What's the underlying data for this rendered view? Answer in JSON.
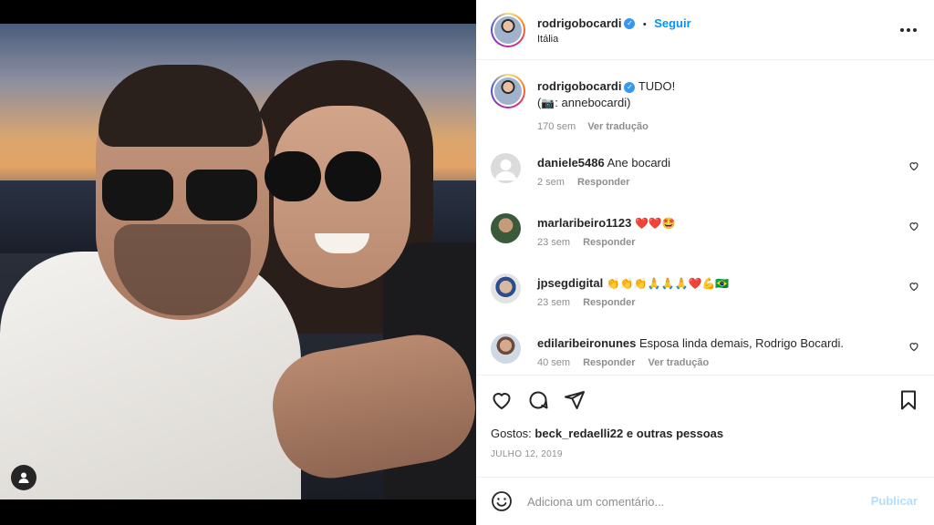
{
  "post": {
    "tag_icon": "user-tag-icon"
  },
  "header": {
    "username": "rodrigobocardi",
    "separator": "•",
    "follow_label": "Seguir",
    "location": "Itália",
    "more_icon": "more-options-icon"
  },
  "caption": {
    "username": "rodrigobocardi",
    "text": "TUDO!",
    "line2_prefix": "(",
    "camera_emoji": "📷",
    "line2_suffix": ": annebocardi)",
    "time": "170 sem",
    "translate": "Ver tradução"
  },
  "comments": [
    {
      "username": "daniele5486",
      "text": "Ane bocardi",
      "time": "2 sem",
      "reply": "Responder",
      "translate": ""
    },
    {
      "username": "marlaribeiro1123",
      "text": "❤️❤️🤩",
      "time": "23 sem",
      "reply": "Responder",
      "translate": ""
    },
    {
      "username": "jpsegdigital",
      "text": "👏👏👏🙏🙏🙏❤️💪🇧🇷",
      "time": "23 sem",
      "reply": "Responder",
      "translate": ""
    },
    {
      "username": "edilaribeironunes",
      "text": "Esposa linda demais, Rodrigo Bocardi.",
      "time": "40 sem",
      "reply": "Responder",
      "translate": "Ver tradução"
    }
  ],
  "actions": {
    "like_icon": "heart-icon",
    "comment_icon": "comment-icon",
    "share_icon": "share-icon",
    "save_icon": "bookmark-icon"
  },
  "likes": {
    "prefix": "Gostos:",
    "user": "beck_redaelli22",
    "suffix": "e outras pessoas"
  },
  "date": "JULHO 12, 2019",
  "add_comment": {
    "placeholder": "Adiciona um comentário...",
    "publish_label": "Publicar",
    "emoji_icon": "emoji-icon"
  },
  "colors": {
    "accent": "#0095f6",
    "publish_disabled": "#b2dffc",
    "heart_red": "#ed4956"
  }
}
